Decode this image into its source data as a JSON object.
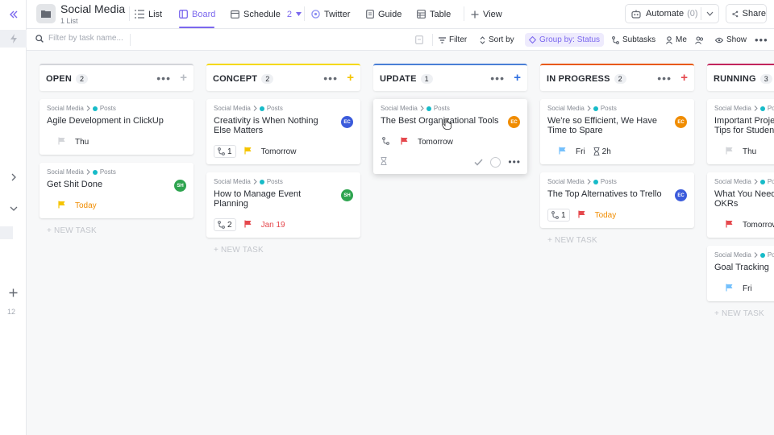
{
  "space": {
    "title": "Social Media",
    "subtitle": "1 List"
  },
  "views": [
    {
      "label": "List",
      "icon": "list-icon"
    },
    {
      "label": "Board",
      "icon": "board-icon",
      "active": true
    },
    {
      "label": "Schedule",
      "icon": "calendar-icon",
      "badge": "2"
    },
    {
      "label": "Twitter",
      "icon": "twitter-icon"
    },
    {
      "label": "Guide",
      "icon": "doc-icon"
    },
    {
      "label": "Table",
      "icon": "table-icon"
    }
  ],
  "add_view": "View",
  "automate": {
    "label": "Automate",
    "count": "(0)"
  },
  "share": "Share",
  "search": {
    "placeholder": "Filter by task name..."
  },
  "toolbar": {
    "filter": "Filter",
    "sort": "Sort by",
    "group": "Group by: Status",
    "subtasks": "Subtasks",
    "me": "Me",
    "show": "Show"
  },
  "rail": {
    "number": "12"
  },
  "columns": [
    {
      "name": "OPEN",
      "count": "2",
      "color": "#d3d5d9",
      "add_color": "#b9bdc4",
      "new_task": "+ NEW TASK",
      "cards": [
        {
          "crumb_space": "Social Media",
          "crumb_list": "Posts",
          "title": "Agile Development in ClickUp",
          "flag_color": "#d3d5d9",
          "due": "Thu",
          "due_color": "normal"
        },
        {
          "crumb_space": "Social Media",
          "crumb_list": "Posts",
          "title": "Get Shit Done",
          "avatar": "SH",
          "avatar_color": "#2ea44f",
          "flag_color": "#f5c400",
          "due": "Today",
          "due_color": "orange"
        }
      ]
    },
    {
      "name": "CONCEPT",
      "count": "2",
      "color": "#f5d90a",
      "add_color": "#f5c400",
      "new_task": "+ NEW TASK",
      "cards": [
        {
          "crumb_space": "Social Media",
          "crumb_list": "Posts",
          "title": "Creativity is When Nothing Else Matters",
          "avatar": "EC",
          "avatar_color": "#3b5bdb",
          "subtasks": "1",
          "flag_color": "#f5c400",
          "due": "Tomorrow",
          "due_color": "normal"
        },
        {
          "crumb_space": "Social Media",
          "crumb_list": "Posts",
          "title": "How to Manage Event Planning",
          "avatar": "SH",
          "avatar_color": "#2ea44f",
          "subtasks": "2",
          "flag_color": "#e5484d",
          "due": "Jan 19",
          "due_color": "red"
        }
      ]
    },
    {
      "name": "UPDATE",
      "count": "1",
      "color": "#4a7fd6",
      "add_color": "#2f6fe0",
      "cards": [
        {
          "crumb_space": "Social Media",
          "crumb_list": "Posts",
          "title": "The Best Organizational Tools",
          "avatar": "EC",
          "avatar_color": "#f08c00",
          "flag_color": "#e5484d",
          "due": "Tomorrow",
          "due_color": "normal",
          "hover": true
        }
      ]
    },
    {
      "name": "IN PROGRESS",
      "count": "2",
      "color": "#e8590c",
      "add_color": "#e5484d",
      "new_task": "+ NEW TASK",
      "cards": [
        {
          "crumb_space": "Social Media",
          "crumb_list": "Posts",
          "title": "We're so Efficient, We Have Time to Spare",
          "avatar": "EC",
          "avatar_color": "#f08c00",
          "flag_color": "#74c0fc",
          "due": "Fri",
          "due_color": "normal",
          "time": "2h"
        },
        {
          "crumb_space": "Social Media",
          "crumb_list": "Posts",
          "title": "The Top Alternatives to Trello",
          "avatar": "EC",
          "avatar_color": "#3b5bdb",
          "subtasks": "1",
          "flag_color": "#e5484d",
          "due": "Today",
          "due_color": "orange"
        }
      ]
    },
    {
      "name": "RUNNING",
      "count": "3",
      "color": "#c2255c",
      "add_color": "#c2255c",
      "new_task": "+ NEW TASK",
      "cards": [
        {
          "crumb_space": "Social Media",
          "crumb_list": "Posts",
          "title": "Important Project Management Tips for Students",
          "flag_color": "#d3d5d9",
          "due": "Thu",
          "due_color": "normal"
        },
        {
          "crumb_space": "Social Media",
          "crumb_list": "Posts",
          "title": "What You Need to Know About OKRs",
          "flag_color": "#e5484d",
          "due": "Tomorrow",
          "due_color": "normal"
        },
        {
          "crumb_space": "Social Media",
          "crumb_list": "Posts",
          "title": "Goal Tracking",
          "flag_color": "#74c0fc",
          "due": "Fri",
          "due_color": "normal"
        }
      ]
    }
  ]
}
